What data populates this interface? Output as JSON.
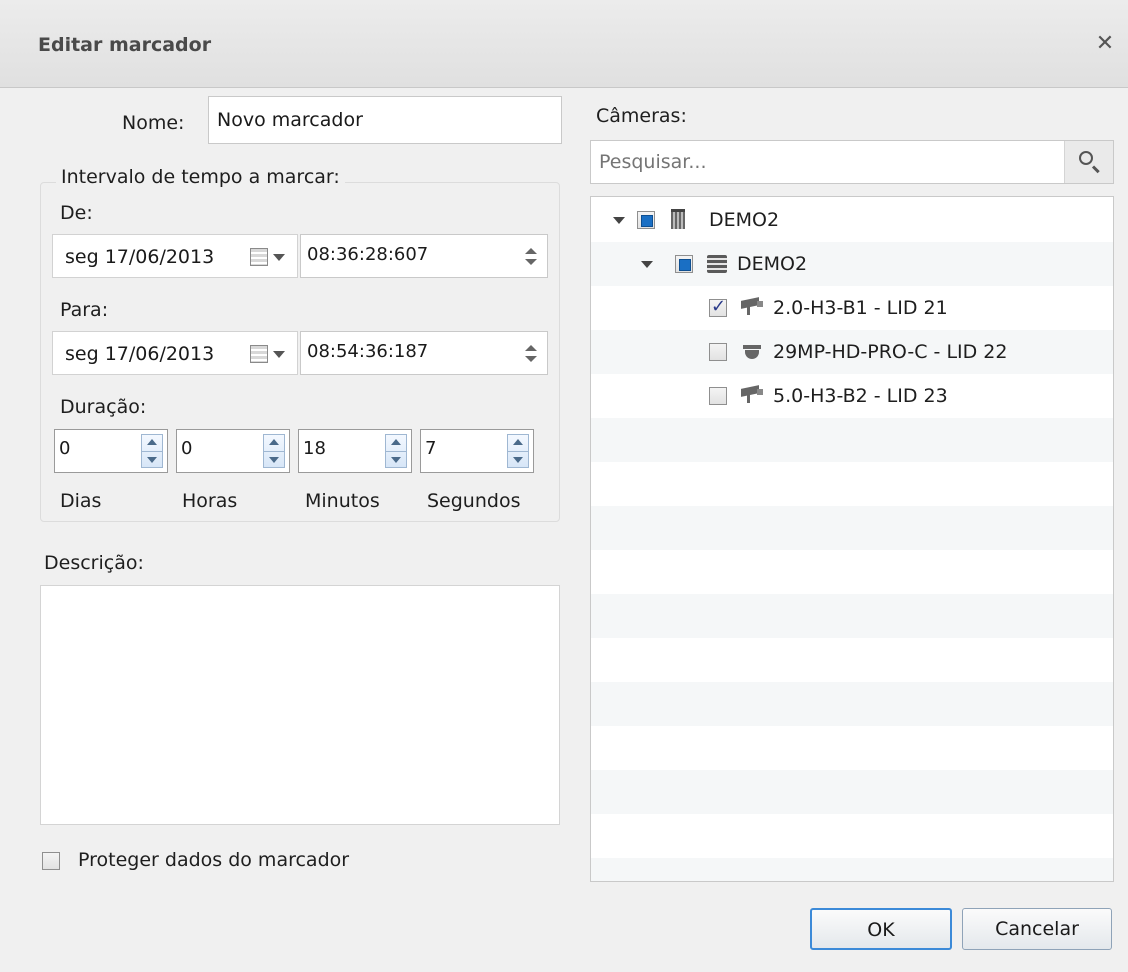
{
  "dialog": {
    "title": "Editar marcador"
  },
  "name": {
    "label": "Nome:",
    "value": "Novo marcador"
  },
  "interval": {
    "legend": "Intervalo de tempo a marcar:",
    "from_label": "De:",
    "from_date": "seg  17/06/2013",
    "from_time": "08:36:28:607",
    "to_label": "Para:",
    "to_date": "seg  17/06/2013",
    "to_time": "08:54:36:187"
  },
  "duration": {
    "label": "Duração:",
    "days": "0",
    "hours": "0",
    "minutes": "18",
    "seconds": "7",
    "days_label": "Dias",
    "hours_label": "Horas",
    "minutes_label": "Minutos",
    "seconds_label": "Segundos"
  },
  "description": {
    "label": "Descrição:",
    "value": ""
  },
  "protect": {
    "label": "Proteger dados do marcador",
    "checked": false
  },
  "cameras": {
    "label": "Câmeras:",
    "search_placeholder": "Pesquisar...",
    "tree": [
      {
        "label": "DEMO2",
        "type": "site",
        "state": "partial",
        "expanded": true
      },
      {
        "label": "DEMO2",
        "type": "server",
        "state": "partial",
        "expanded": true
      },
      {
        "label": "2.0-H3-B1 - LID 21",
        "type": "camera",
        "state": "checked"
      },
      {
        "label": "29MP-HD-PRO-C - LID 22",
        "type": "dome-camera",
        "state": "unchecked"
      },
      {
        "label": "5.0-H3-B2 - LID 23",
        "type": "camera",
        "state": "unchecked"
      }
    ]
  },
  "buttons": {
    "ok": "OK",
    "cancel": "Cancelar"
  },
  "colors": {
    "accent": "#3c8ad8",
    "partial_check": "#1a6fc4"
  }
}
